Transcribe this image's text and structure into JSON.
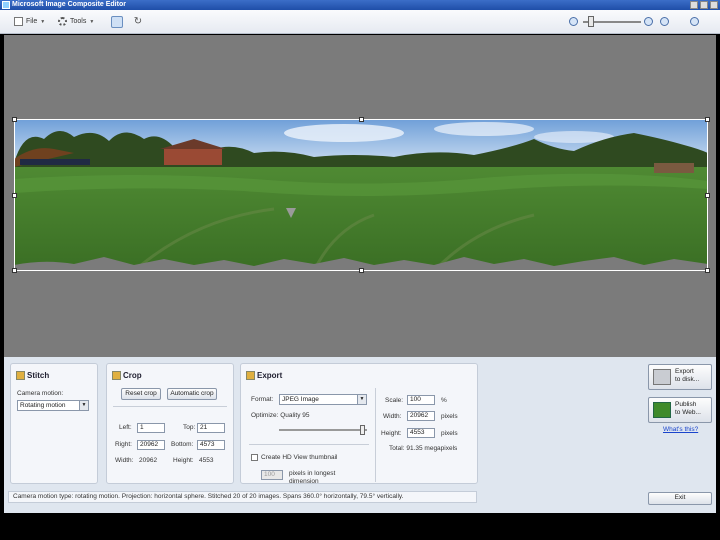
{
  "window": {
    "title": "Microsoft Image Composite Editor"
  },
  "toolbar": {
    "file_label": "File",
    "tools_label": "Tools",
    "file_icon": "document-icon",
    "tools_icon": "gear-icon"
  },
  "stitch": {
    "title": "Stitch",
    "camera_motion_label": "Camera motion:",
    "camera_motion_value": "Rotating motion"
  },
  "crop": {
    "title": "Crop",
    "reset_crop_label": "Reset crop",
    "automatic_crop_label": "Automatic crop",
    "left_label": "Left:",
    "left_value": "1",
    "top_label": "Top:",
    "top_value": "21",
    "right_label": "Right:",
    "right_value": "20962",
    "bottom_label": "Bottom:",
    "bottom_value": "4573",
    "width_label": "Width:",
    "width_value": "20962",
    "height_label": "Height:",
    "height_value": "4553"
  },
  "export": {
    "title": "Export",
    "format_label": "Format:",
    "format_value": "JPEG Image",
    "quality_label": "Optimize: Quality 95",
    "quality_value": 95,
    "scale_label": "Scale:",
    "scale_value": "100",
    "scale_unit": "%",
    "width_label": "Width:",
    "width_value": "20962",
    "width_unit": "pixels",
    "height_label": "Height:",
    "height_value": "4553",
    "height_unit": "pixels",
    "total_label": "Total: 91.35 megapixels",
    "thumbnail_label": "Create HD View thumbnail",
    "thumbnail_size_value": "100",
    "thumbnail_size_label": "pixels in longest dimension"
  },
  "actions": {
    "export_disk_label_1": "Export",
    "export_disk_label_2": "to disk...",
    "publish_label_1": "Publish",
    "publish_label_2": "to Web...",
    "whats_this_label": "What's this?",
    "exit_label": "Exit"
  },
  "status": {
    "text": "Camera motion type: rotating motion. Projection: horizontal sphere. Stitched 20 of 20 images. Spans 360.0° horizontally, 79.5° vertically."
  },
  "colors": {
    "sky": "#9cc0e6",
    "grass": "#3f7a2a",
    "panel": "#dfe6ef",
    "canvas": "#7b7b7b"
  }
}
